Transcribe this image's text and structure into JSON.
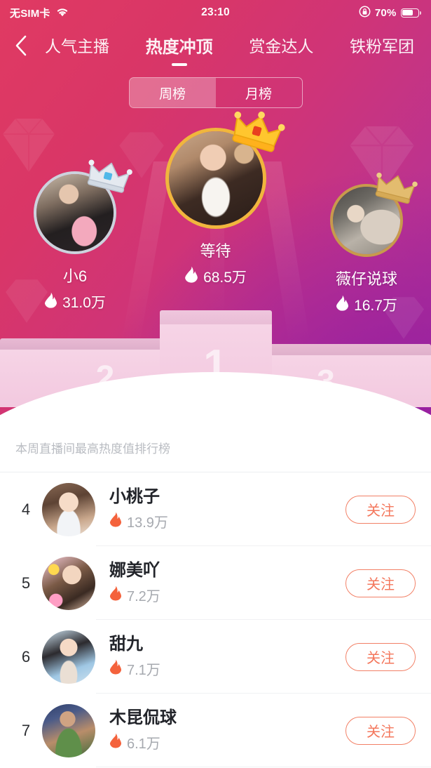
{
  "status_bar": {
    "carrier": "无SIM卡",
    "wifi_icon": "wifi-icon",
    "time": "23:10",
    "rotation_lock_icon": "rotation-lock-icon",
    "battery_percent": "70%",
    "battery_level": 70,
    "battery_icon": "battery-icon"
  },
  "nav": {
    "back_icon": "chevron-left-icon",
    "tabs": [
      {
        "label": "人气主播",
        "active": false
      },
      {
        "label": "热度冲顶",
        "active": true
      },
      {
        "label": "赏金达人",
        "active": false
      },
      {
        "label": "铁粉军团",
        "active": false
      }
    ]
  },
  "period_toggle": {
    "options": [
      {
        "label": "周榜",
        "selected": true
      },
      {
        "label": "月榜",
        "selected": false
      }
    ]
  },
  "podium": {
    "winners": [
      {
        "rank": "1",
        "name": "等待",
        "heat": "68.5万",
        "crown": "gold-crown-icon",
        "ring_color": "#f0b63d",
        "flame_icon": "flame-icon"
      },
      {
        "rank": "2",
        "name": "小6",
        "heat": "31.0万",
        "crown": "silver-crown-icon",
        "ring_color": "#c8cfda",
        "flame_icon": "flame-icon"
      },
      {
        "rank": "3",
        "name": "薇仔说球",
        "heat": "16.7万",
        "crown": "bronze-crown-icon",
        "ring_color": "#c79b4e",
        "flame_icon": "flame-icon"
      }
    ],
    "block_numbers": {
      "first": "1",
      "second": "2",
      "third": "3"
    }
  },
  "list": {
    "caption": "本周直播间最高热度值排行榜",
    "follow_label": "关注",
    "flame_icon": "flame-icon",
    "rows": [
      {
        "rank": "4",
        "name": "小桃子",
        "heat": "13.9万"
      },
      {
        "rank": "5",
        "name": "娜美吖",
        "heat": "7.2万"
      },
      {
        "rank": "6",
        "name": "甜九",
        "heat": "7.1万"
      },
      {
        "rank": "7",
        "name": "木昆侃球",
        "heat": "6.1万"
      }
    ]
  },
  "colors": {
    "gradient_start": "#e03a62",
    "gradient_end": "#a32f9e",
    "podium_pink": "#f2c9df",
    "follow_accent": "#f4775c",
    "caption_gray": "#b9bcc2"
  }
}
